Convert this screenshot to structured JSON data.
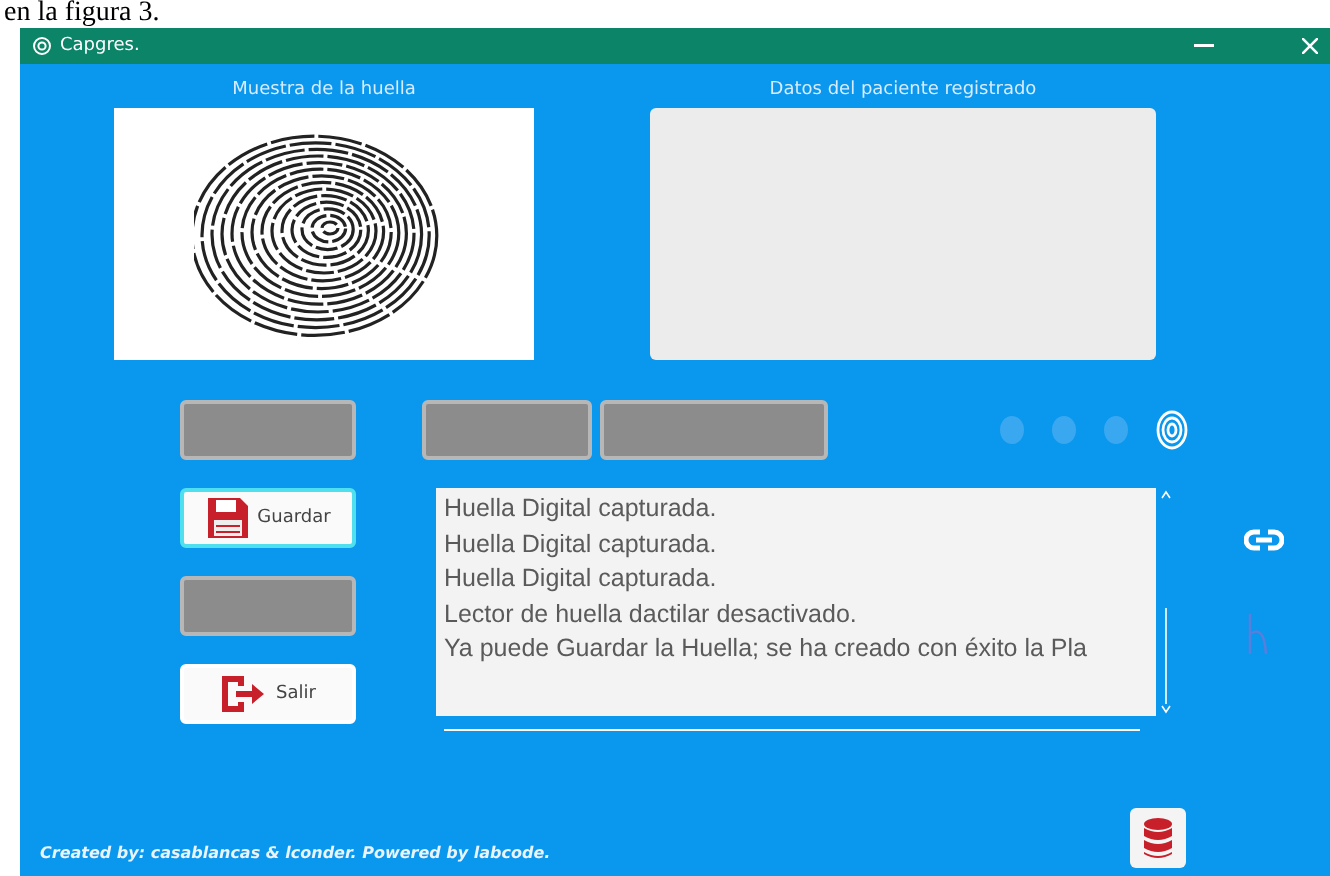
{
  "document_text": "en la figura 3.",
  "window": {
    "title": "Capgres."
  },
  "fingerprint_panel": {
    "title": "Muestra de la huella"
  },
  "patient_panel": {
    "title": "Datos del paciente registrado"
  },
  "side_buttons": [
    {
      "disabled": true
    },
    {
      "kind": "save",
      "label": "Guardar",
      "disabled": false,
      "focused": true
    },
    {
      "disabled": true
    },
    {
      "kind": "exit",
      "label": "Salir",
      "disabled": false,
      "focused": false
    }
  ],
  "toolbar_buttons": [
    {
      "disabled": true
    },
    {
      "disabled": true
    }
  ],
  "indicators": [
    {
      "on": false
    },
    {
      "on": false
    },
    {
      "on": false
    }
  ],
  "log": {
    "lines": [
      "Huella Digital capturada.",
      "Huella Digital capturada.",
      "Huella Digital capturada.",
      "Lector de huella dactilar desactivado.",
      "Ya puede Guardar la Huella; se ha creado con éxito la Pla"
    ]
  },
  "footer": {
    "credit": "Created by: casablancas & lconder. Powered by labcode."
  }
}
